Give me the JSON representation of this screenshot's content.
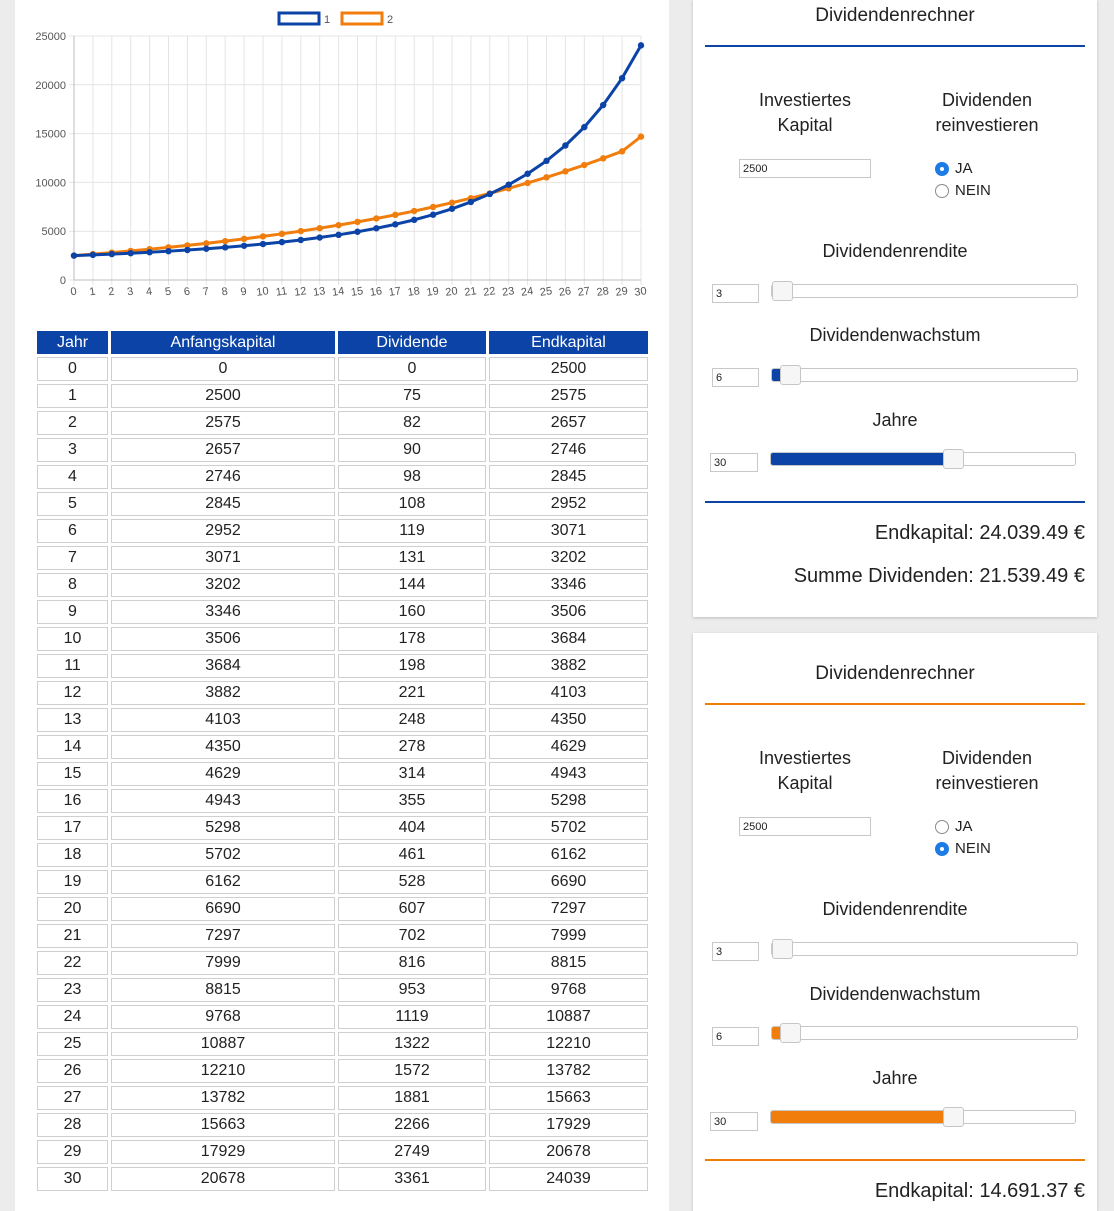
{
  "chart_data": {
    "type": "line",
    "x": [
      0,
      1,
      2,
      3,
      4,
      5,
      6,
      7,
      8,
      9,
      10,
      11,
      12,
      13,
      14,
      15,
      16,
      17,
      18,
      19,
      20,
      21,
      22,
      23,
      24,
      25,
      26,
      27,
      28,
      29,
      30
    ],
    "ylim": [
      0,
      25000
    ],
    "yticks": [
      "0",
      "5000",
      "10000",
      "15000",
      "20000",
      "25000"
    ],
    "grid": true,
    "legend_position": "top-center",
    "series": [
      {
        "name": "1",
        "color": "#0b43a6",
        "values": [
          2500,
          2575,
          2657,
          2746,
          2845,
          2952,
          3071,
          3202,
          3346,
          3506,
          3684,
          3882,
          4103,
          4350,
          4629,
          4943,
          5298,
          5702,
          6162,
          6690,
          7297,
          7999,
          8815,
          9768,
          10887,
          12210,
          13782,
          15663,
          17929,
          20678,
          24039
        ]
      },
      {
        "name": "2",
        "color": "#f07d0c",
        "values": [
          2500,
          2650,
          2810,
          2979,
          3157,
          3346,
          3545,
          3756,
          3980,
          4216,
          4466,
          4731,
          5011,
          5307,
          5621,
          5953,
          6303,
          6674,
          7066,
          7481,
          7920,
          8384,
          8874,
          9393,
          9941,
          10520,
          11133,
          11780,
          12464,
          13186,
          14691
        ]
      }
    ]
  },
  "table": {
    "headers": [
      "Jahr",
      "Anfangskapital",
      "Dividende",
      "Endkapital"
    ],
    "rows": [
      [
        "0",
        "0",
        "0",
        "2500"
      ],
      [
        "1",
        "2500",
        "75",
        "2575"
      ],
      [
        "2",
        "2575",
        "82",
        "2657"
      ],
      [
        "3",
        "2657",
        "90",
        "2746"
      ],
      [
        "4",
        "2746",
        "98",
        "2845"
      ],
      [
        "5",
        "2845",
        "108",
        "2952"
      ],
      [
        "6",
        "2952",
        "119",
        "3071"
      ],
      [
        "7",
        "3071",
        "131",
        "3202"
      ],
      [
        "8",
        "3202",
        "144",
        "3346"
      ],
      [
        "9",
        "3346",
        "160",
        "3506"
      ],
      [
        "10",
        "3506",
        "178",
        "3684"
      ],
      [
        "11",
        "3684",
        "198",
        "3882"
      ],
      [
        "12",
        "3882",
        "221",
        "4103"
      ],
      [
        "13",
        "4103",
        "248",
        "4350"
      ],
      [
        "14",
        "4350",
        "278",
        "4629"
      ],
      [
        "15",
        "4629",
        "314",
        "4943"
      ],
      [
        "16",
        "4943",
        "355",
        "5298"
      ],
      [
        "17",
        "5298",
        "404",
        "5702"
      ],
      [
        "18",
        "5702",
        "461",
        "6162"
      ],
      [
        "19",
        "6162",
        "528",
        "6690"
      ],
      [
        "20",
        "6690",
        "607",
        "7297"
      ],
      [
        "21",
        "7297",
        "702",
        "7999"
      ],
      [
        "22",
        "7999",
        "816",
        "8815"
      ],
      [
        "23",
        "8815",
        "953",
        "9768"
      ],
      [
        "24",
        "9768",
        "1119",
        "10887"
      ],
      [
        "25",
        "10887",
        "1322",
        "12210"
      ],
      [
        "26",
        "12210",
        "1572",
        "13782"
      ],
      [
        "27",
        "13782",
        "1881",
        "15663"
      ],
      [
        "28",
        "15663",
        "2266",
        "17929"
      ],
      [
        "29",
        "17929",
        "2749",
        "20678"
      ],
      [
        "30",
        "20678",
        "3361",
        "24039"
      ]
    ]
  },
  "calc1": {
    "accent": "#0b43a6",
    "title": "Dividendenrechner",
    "capital_label_1": "Investiertes",
    "capital_label_2": "Kapital",
    "capital_value": "2500",
    "reinvest_label_1": "Dividenden",
    "reinvest_label_2": "reinvestieren",
    "opt_yes": "JA",
    "opt_no": "NEIN",
    "reinvest": "JA",
    "yield_label": "Dividendenrendite",
    "yield_value": "3",
    "yield_slider": 0.0,
    "growth_label": "Dividendenwachstum",
    "growth_value": "6",
    "growth_slider": 0.06,
    "years_label": "Jahre",
    "years_value": "30",
    "years_slider": 0.6,
    "result_end": "Endkapital: 24.039.49 €",
    "result_div": "Summe Dividenden: 21.539.49 €"
  },
  "calc2": {
    "accent": "#f07d0c",
    "title": "Dividendenrechner",
    "capital_label_1": "Investiertes",
    "capital_label_2": "Kapital",
    "capital_value": "2500",
    "reinvest_label_1": "Dividenden",
    "reinvest_label_2": "reinvestieren",
    "opt_yes": "JA",
    "opt_no": "NEIN",
    "reinvest": "NEIN",
    "yield_label": "Dividendenrendite",
    "yield_value": "3",
    "yield_slider": 0.0,
    "growth_label": "Dividendenwachstum",
    "growth_value": "6",
    "growth_slider": 0.06,
    "years_label": "Jahre",
    "years_value": "30",
    "years_slider": 0.6,
    "result_end": "Endkapital: 14.691.37 €"
  }
}
